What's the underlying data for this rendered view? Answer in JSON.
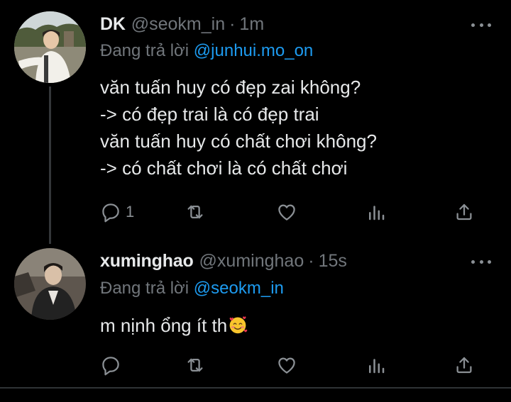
{
  "tweets": [
    {
      "display_name": "DK",
      "handle": "@seokm_in",
      "separator": "·",
      "time": "1m",
      "replying_prefix": "Đang trả lời",
      "replying_to": "@junhui.mo_on",
      "lines": [
        "văn tuấn huy có đẹp zai không?",
        "-> có đẹp trai là có đẹp trai",
        "văn tuấn huy có chất chơi không?",
        "-> có chất chơi là có chất chơi"
      ],
      "reply_count": "1",
      "icons": [
        "reply-icon",
        "retweet-icon",
        "like-icon",
        "views-icon",
        "share-icon",
        "more-icon"
      ]
    },
    {
      "display_name": "xuminghao",
      "handle": "@xuminghao",
      "separator": "·",
      "time": "15s",
      "replying_prefix": "Đang trả lời",
      "replying_to": "@seokm_in",
      "text": "m nịnh ổng ít th",
      "emoji": "smiling-face-with-hearts",
      "icons": [
        "reply-icon",
        "retweet-icon",
        "like-icon",
        "views-icon",
        "share-icon",
        "more-icon"
      ]
    }
  ],
  "colors": {
    "background": "#000000",
    "text": "#e7e9ea",
    "muted": "#71767b",
    "mention": "#1d9bf0",
    "thread_line": "#333639"
  }
}
